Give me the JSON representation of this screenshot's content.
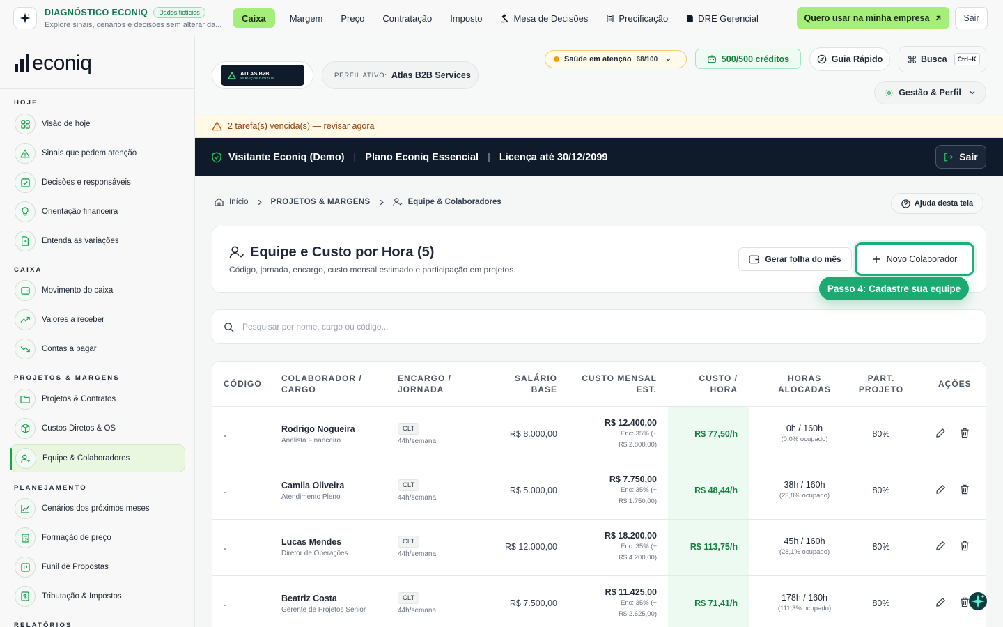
{
  "topbar": {
    "brand_title": "DIAGNÓSTICO ECONIQ",
    "brand_badge": "Dados fictícios",
    "brand_subtitle": "Explore sinais, cenários e decisões sem alterar da...",
    "nav": [
      {
        "label": "Caixa",
        "active": true
      },
      {
        "label": "Margem"
      },
      {
        "label": "Preço"
      },
      {
        "label": "Contratação"
      },
      {
        "label": "Imposto"
      },
      {
        "label": "Mesa de Decisões",
        "icon": "gavel-icon"
      },
      {
        "label": "Precificação",
        "icon": "calculator-icon"
      },
      {
        "label": "DRE Gerencial",
        "icon": "document-icon"
      }
    ],
    "cta_label": "Quero usar na minha empresa",
    "logout_label": "Sair"
  },
  "sidebar": {
    "logo_text": "econiq",
    "sections": [
      {
        "title": "HOJE",
        "items": [
          {
            "label": "Visão de hoje",
            "icon": "grid-icon"
          },
          {
            "label": "Sinais que pedem atenção",
            "icon": "warning-icon"
          },
          {
            "label": "Decisões e responsáveis",
            "icon": "checkbox-icon"
          },
          {
            "label": "Orientação financeira",
            "icon": "lightbulb-icon"
          },
          {
            "label": "Entenda as variações",
            "icon": "file-swap-icon"
          }
        ]
      },
      {
        "title": "CAIXA",
        "items": [
          {
            "label": "Movimento do caixa",
            "icon": "wallet-icon"
          },
          {
            "label": "Valores a receber",
            "icon": "trend-up-icon"
          },
          {
            "label": "Contas a pagar",
            "icon": "trend-down-icon"
          }
        ]
      },
      {
        "title": "PROJETOS & MARGENS",
        "items": [
          {
            "label": "Projetos & Contratos",
            "icon": "folder-icon"
          },
          {
            "label": "Custos Diretos & OS",
            "icon": "box-icon"
          },
          {
            "label": "Equipe & Colaboradores",
            "icon": "user-check-icon",
            "active": true
          }
        ]
      },
      {
        "title": "PLANEJAMENTO",
        "items": [
          {
            "label": "Cenários dos próximos meses",
            "icon": "line-chart-icon"
          },
          {
            "label": "Formação de preço",
            "icon": "calculator-icon"
          },
          {
            "label": "Funil de Propostas",
            "icon": "kanban-icon"
          },
          {
            "label": "Tributação & Impostos",
            "icon": "receipt-icon"
          }
        ]
      },
      {
        "title": "RELATÓRIOS",
        "items": []
      }
    ]
  },
  "header": {
    "company_name": "ATLAS B2B",
    "company_tagline": "SERVIÇOS DIGITAIS",
    "profile_label": "PERFIL ATIVO:",
    "profile_value": "Atlas B2B Services",
    "health_label": "Saúde em atenção",
    "health_score": "68/100",
    "credits": "500/500 créditos",
    "guide_label": "Guia Rápido",
    "search_label": "Busca",
    "search_shortcut": "Ctrl+K",
    "gestao_label": "Gestão & Perfil"
  },
  "alert": {
    "text": "2 tarefa(s) vencida(s) — revisar agora"
  },
  "license": {
    "user": "Visitante Econiq (Demo)",
    "plan": "Plano Econiq Essencial",
    "validity": "Licença até 30/12/2099",
    "logout": "Sair"
  },
  "breadcrumb": {
    "home": "Início",
    "section": "PROJETOS & MARGENS",
    "current": "Equipe & Colaboradores",
    "help": "Ajuda desta tela"
  },
  "page": {
    "title": "Equipe e Custo por Hora (5)",
    "subtitle": "Código, jornada, encargo, custo mensal estimado e participação em projetos.",
    "folha_button": "Gerar folha do mês",
    "new_button": "Novo Colaborador",
    "tour_tip": "Passo 4: Cadastre sua equipe",
    "search_placeholder": "Pesquisar por nome, cargo ou código..."
  },
  "table": {
    "headers": {
      "codigo": "CÓDIGO",
      "colaborador_1": "COLABORADOR /",
      "colaborador_2": "CARGO",
      "encargo_1": "ENCARGO /",
      "encargo_2": "JORNADA",
      "salario_1": "SALÁRIO",
      "salario_2": "BASE",
      "mensal_1": "CUSTO MENSAL",
      "mensal_2": "EST.",
      "hora_1": "CUSTO /",
      "hora_2": "HORA",
      "horas_1": "HORAS",
      "horas_2": "ALOCADAS",
      "part_1": "PART.",
      "part_2": "PROJETO",
      "acoes": "AÇÕES"
    },
    "rows": [
      {
        "code": "-",
        "name": "Rodrigo Nogueira",
        "role": "Analista Financeiro",
        "tag": "CLT",
        "jornada": "44h/semana",
        "salario": "R$ 8.000,00",
        "mensal": "R$ 12.400,00",
        "encargo_1": "Enc: 35% (+",
        "encargo_2": "R$ 2.800,00)",
        "hora": "R$ 77,50/h",
        "horas": "0h / 160h",
        "ocupado": "(0,0% ocupado)",
        "part": "80%"
      },
      {
        "code": "-",
        "name": "Camila Oliveira",
        "role": "Atendimento Pleno",
        "tag": "CLT",
        "jornada": "44h/semana",
        "salario": "R$ 5.000,00",
        "mensal": "R$ 7.750,00",
        "encargo_1": "Enc: 35% (+",
        "encargo_2": "R$ 1.750,00)",
        "hora": "R$ 48,44/h",
        "horas": "38h / 160h",
        "ocupado": "(23,8% ocupado)",
        "part": "80%"
      },
      {
        "code": "-",
        "name": "Lucas Mendes",
        "role": "Diretor de Operações",
        "tag": "CLT",
        "jornada": "44h/semana",
        "salario": "R$ 12.000,00",
        "mensal": "R$ 18.200,00",
        "encargo_1": "Enc: 35% (+",
        "encargo_2": "R$ 4.200,00)",
        "hora": "R$ 113,75/h",
        "horas": "45h / 160h",
        "ocupado": "(28,1% ocupado)",
        "part": "80%"
      },
      {
        "code": "-",
        "name": "Beatriz Costa",
        "role": "Gerente de Projetos Senior",
        "tag": "CLT",
        "jornada": "44h/semana",
        "salario": "R$ 7.500,00",
        "mensal": "R$ 11.425,00",
        "encargo_1": "Enc: 35% (+",
        "encargo_2": "R$ 2.625,00)",
        "hora": "R$ 71,41/h",
        "horas": "178h / 160h",
        "ocupado": "(111,3% ocupado)",
        "part": "80%"
      }
    ]
  },
  "colors": {
    "accent": "#a6ee7a",
    "brand_green": "#1bab72",
    "dark": "#0f1a2b",
    "warning": "#f59e0b"
  }
}
